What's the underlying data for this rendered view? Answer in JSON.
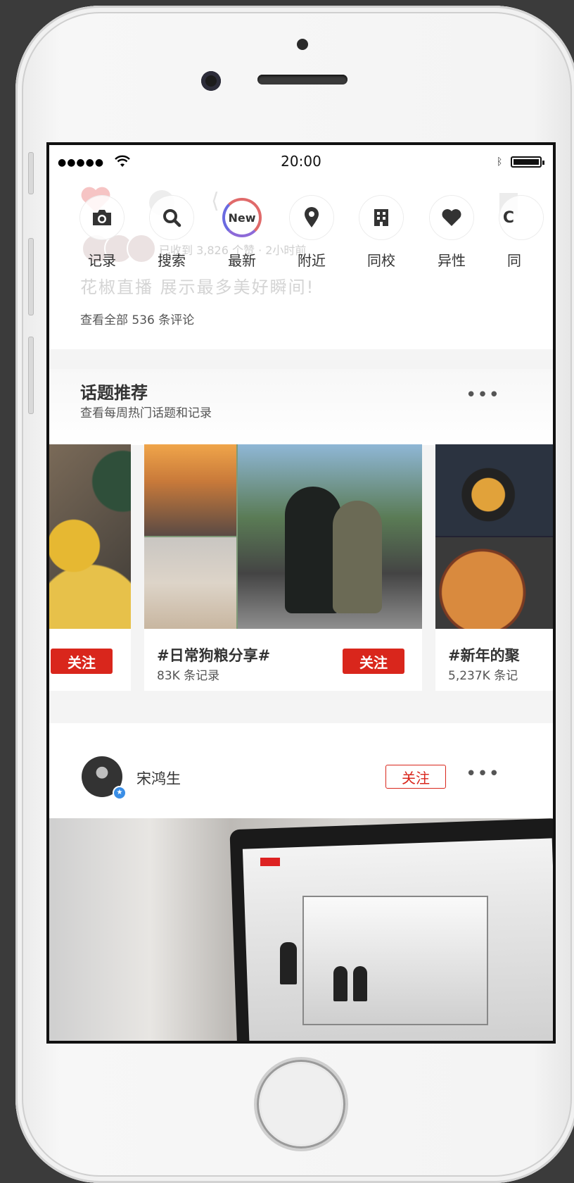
{
  "status_bar": {
    "time": "20:00",
    "signal": "●●●●●"
  },
  "faded_post": {
    "meta": "已收到 3,826 个赞 · 2小时前",
    "caption": "花椒直播  展示最多美好瞬间!",
    "comments_link": "查看全部 536 条评论"
  },
  "shortcuts": [
    {
      "label": "记录",
      "icon": "camera-icon"
    },
    {
      "label": "搜索",
      "icon": "search-icon"
    },
    {
      "label": "最新",
      "icon": "new-badge-icon",
      "badge": "New"
    },
    {
      "label": "附近",
      "icon": "location-pin-icon"
    },
    {
      "label": "同校",
      "icon": "building-icon"
    },
    {
      "label": "异性",
      "icon": "heart-icon"
    },
    {
      "label": "同",
      "icon": "circle-icon"
    }
  ],
  "topics": {
    "title": "话题推荐",
    "subtitle": "查看每周热门话题和记录",
    "cards": [
      {
        "tag": "",
        "count": "",
        "follow_label": "关注"
      },
      {
        "tag": "#日常狗粮分享#",
        "count": "83K 条记录",
        "follow_label": "关注"
      },
      {
        "tag": "#新年的聚",
        "count": "5,237K 条记"
      }
    ]
  },
  "post": {
    "username": "宋鸿生",
    "follow_label": "关注",
    "badge": "★"
  },
  "colors": {
    "accent": "#d9261c",
    "verified": "#3a8ee6"
  }
}
